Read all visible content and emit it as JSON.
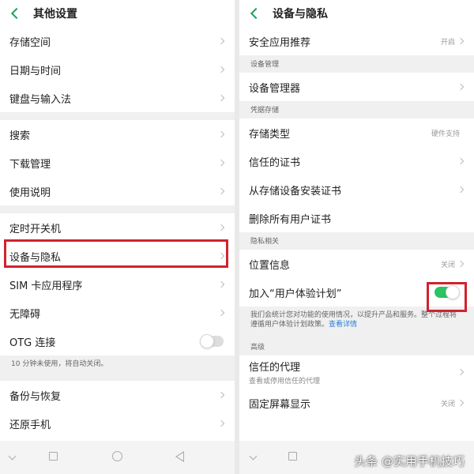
{
  "colors": {
    "accent": "#1aa25b",
    "toggle_on": "#2ac463",
    "highlight": "#d0232e",
    "link": "#2b7fd7"
  },
  "left": {
    "title": "其他设置",
    "items": [
      {
        "label": "存储空间"
      },
      {
        "label": "日期与时间"
      },
      {
        "label": "键盘与输入法"
      },
      {
        "label": "搜索"
      },
      {
        "label": "下载管理"
      },
      {
        "label": "使用说明"
      },
      {
        "label": "定时开关机"
      },
      {
        "label": "设备与隐私"
      },
      {
        "label": "SIM 卡应用程序"
      },
      {
        "label": "无障碍"
      },
      {
        "label": "OTG 连接",
        "toggle": "off"
      },
      {
        "label": "备份与恢复"
      },
      {
        "label": "还原手机"
      }
    ],
    "otg_note": "10 分钟未使用，将自动关闭。"
  },
  "right": {
    "title": "设备与隐私",
    "safe_app": {
      "label": "安全应用推荐",
      "value": "开启"
    },
    "section_device": "设备管理",
    "device_manager": {
      "label": "设备管理器"
    },
    "section_credential": "凭据存储",
    "storage_type": {
      "label": "存储类型",
      "value": "硬件支持"
    },
    "trusted_certs": {
      "label": "信任的证书"
    },
    "install_certs": {
      "label": "从存储设备安装证书"
    },
    "delete_certs": {
      "label": "删除所有用户证书"
    },
    "section_privacy": "隐私相关",
    "location": {
      "label": "位置信息",
      "value": "关闭"
    },
    "ux_plan": {
      "label": "加入“用户体验计划”",
      "toggle": "on"
    },
    "ux_note": "我们会统计您对功能的使用情况，以提升产品和服务。整个过程将遵循用户体验计划政策。",
    "ux_note_link": "查看详情",
    "section_advanced": "高级",
    "trust_agents": {
      "label": "信任的代理",
      "sub": "查看或停用信任的代理"
    },
    "screen_pin": {
      "label": "固定屏幕显示",
      "value": "关闭"
    }
  },
  "navbar": {
    "icons": [
      "nav-back-icon",
      "nav-recents-icon",
      "nav-home-icon",
      "nav-back-triangle-icon"
    ]
  },
  "watermark": "头条 @实用手机技巧"
}
